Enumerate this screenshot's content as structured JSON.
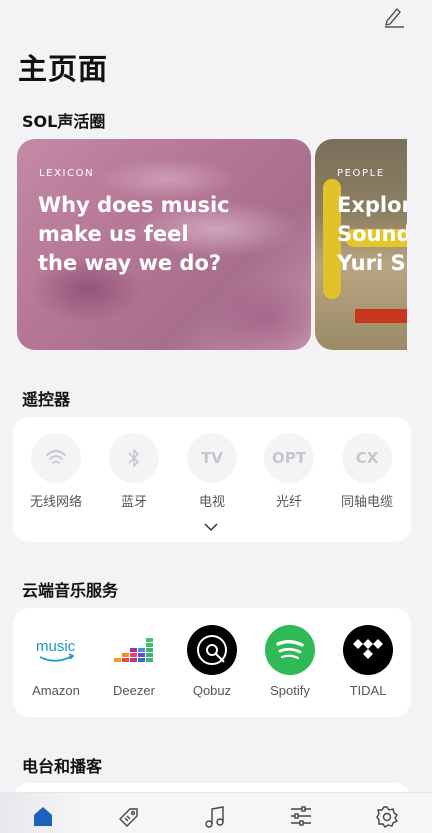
{
  "header": {
    "title": "主页面"
  },
  "sections": {
    "sol": "SOL声活圈",
    "remote": "遥控器",
    "cloud": "云端音乐服务",
    "radio": "电台和播客"
  },
  "cards": [
    {
      "tag": "LEXICON",
      "headline": "Why does music\nmake us feel\nthe way we do?"
    },
    {
      "tag": "PEOPLE",
      "headline": "Explor\nSound\nYuri Su"
    }
  ],
  "remote": {
    "sources": [
      {
        "icon": "wifi-icon",
        "label": "无线网络"
      },
      {
        "icon": "bluetooth-icon",
        "label": "蓝牙"
      },
      {
        "icon": "tv-icon",
        "text": "TV",
        "label": "电视"
      },
      {
        "icon": "opt-icon",
        "text": "OPT",
        "label": "光纤"
      },
      {
        "icon": "cx-icon",
        "text": "CX",
        "label": "同轴电缆"
      }
    ]
  },
  "cloud": {
    "services": [
      {
        "icon": "amazon-music-logo",
        "label": "Amazon",
        "logo_text": "music"
      },
      {
        "icon": "deezer-logo",
        "label": "Deezer"
      },
      {
        "icon": "qobuz-logo",
        "label": "Qobuz"
      },
      {
        "icon": "spotify-logo",
        "label": "Spotify"
      },
      {
        "icon": "tidal-logo",
        "label": "TIDAL"
      }
    ]
  },
  "colors": {
    "accent": "#1f5fbf",
    "spotify": "#2fb957",
    "amazon": "#1a98c8"
  },
  "nav": [
    "home-icon",
    "tag-icon",
    "music-note-icon",
    "equalizer-icon",
    "settings-icon"
  ]
}
